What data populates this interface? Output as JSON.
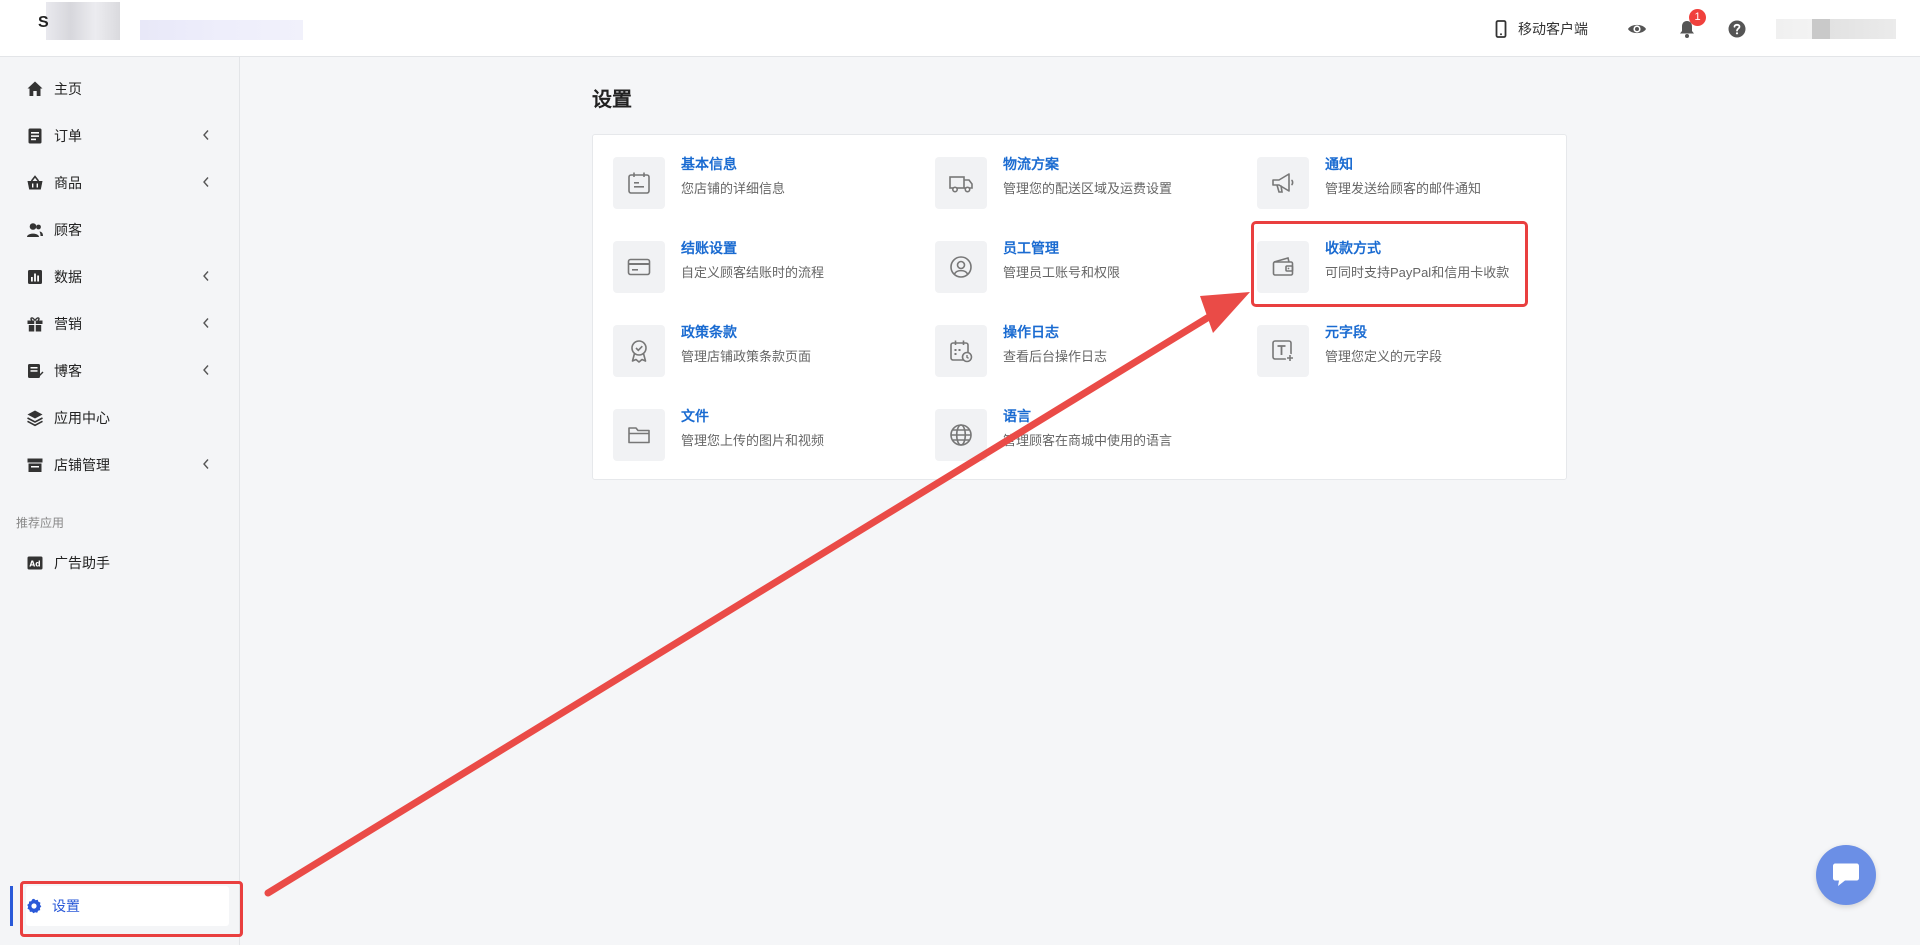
{
  "header": {
    "logo_letter": "S",
    "mobile_label": "移动客户端",
    "notification_count": "1"
  },
  "sidebar": {
    "items": [
      {
        "label": "主页",
        "icon": "home-icon",
        "has_chevron": false
      },
      {
        "label": "订单",
        "icon": "orders-icon",
        "has_chevron": true
      },
      {
        "label": "商品",
        "icon": "basket-icon",
        "has_chevron": true
      },
      {
        "label": "顾客",
        "icon": "users-icon",
        "has_chevron": false
      },
      {
        "label": "数据",
        "icon": "chart-icon",
        "has_chevron": true
      },
      {
        "label": "营销",
        "icon": "gift-icon",
        "has_chevron": true
      },
      {
        "label": "博客",
        "icon": "blog-icon",
        "has_chevron": true
      },
      {
        "label": "应用中心",
        "icon": "layers-icon",
        "has_chevron": false
      },
      {
        "label": "店铺管理",
        "icon": "store-icon",
        "has_chevron": true
      }
    ],
    "section_label": "推荐应用",
    "recommended": [
      {
        "label": "广告助手",
        "icon": "ad-icon"
      }
    ],
    "settings_label": "设置"
  },
  "main": {
    "title": "设置",
    "settings": [
      {
        "title": "基本信息",
        "desc": "您店铺的详细信息",
        "icon": "calendar-icon"
      },
      {
        "title": "物流方案",
        "desc": "管理您的配送区域及运费设置",
        "icon": "truck-icon"
      },
      {
        "title": "通知",
        "desc": "管理发送给顾客的邮件通知",
        "icon": "megaphone-icon"
      },
      {
        "title": "结账设置",
        "desc": "自定义顾客结账时的流程",
        "icon": "credit-card-icon"
      },
      {
        "title": "员工管理",
        "desc": "管理员工账号和权限",
        "icon": "user-circle-icon"
      },
      {
        "title": "收款方式",
        "desc": "可同时支持PayPal和信用卡收款",
        "icon": "wallet-icon"
      },
      {
        "title": "政策条款",
        "desc": "管理店铺政策条款页面",
        "icon": "badge-check-icon"
      },
      {
        "title": "操作日志",
        "desc": "查看后台操作日志",
        "icon": "log-calendar-icon"
      },
      {
        "title": "元字段",
        "desc": "管理您定义的元字段",
        "icon": "text-plus-icon"
      },
      {
        "title": "文件",
        "desc": "管理您上传的图片和视频",
        "icon": "folder-icon"
      },
      {
        "title": "语言",
        "desc": "管理顾客在商城中使用的语言",
        "icon": "globe-icon"
      }
    ]
  },
  "colors": {
    "accent": "#2a59d8",
    "link": "#1a6bd1",
    "annotation": "#e93f3f",
    "chat": "#6b8fe6"
  }
}
